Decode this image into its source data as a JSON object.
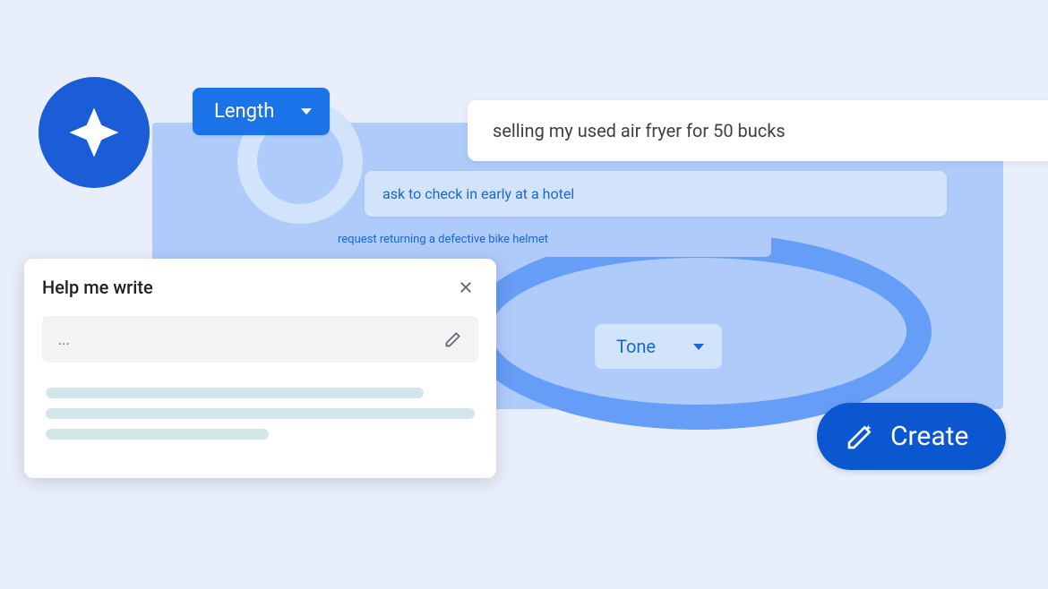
{
  "length_dropdown": {
    "label": "Length"
  },
  "tone_dropdown": {
    "label": "Tone"
  },
  "prompts": {
    "prompt1": "selling my used air fryer for 50 bucks",
    "prompt2": "ask to check in early at a hotel",
    "prompt3": "request returning a defective bike helmet"
  },
  "help_panel": {
    "title": "Help me write",
    "input_placeholder": "..."
  },
  "create_button": {
    "label": "Create"
  }
}
